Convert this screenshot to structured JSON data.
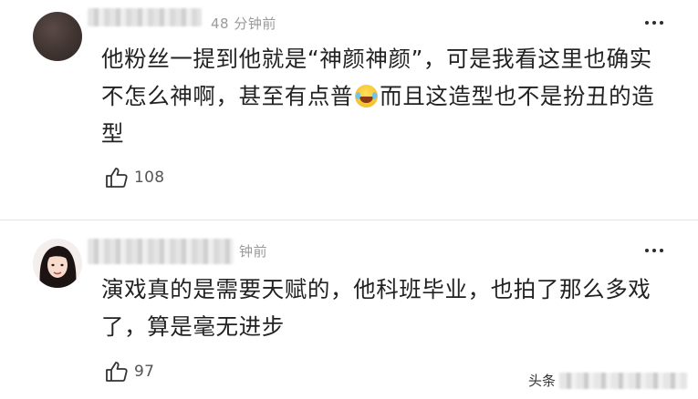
{
  "comments": [
    {
      "time": "48 分钟前",
      "text_before_emoji": "他粉丝一提到他就是“神颜神颜”，可是我看这里也确实不怎么神啊，甚至有点普",
      "emoji": "laughing-crying-emoji",
      "text_after_emoji": "而且这造型也不是扮丑的造型",
      "likes": "108"
    },
    {
      "time": "钟前",
      "text": "演戏真的是需要天赋的，他科班毕业，也拍了那么多戏了，算是毫无进步",
      "likes": "97"
    }
  ],
  "watermark": {
    "label": "头条"
  },
  "colors": {
    "text": "#222222",
    "meta": "#9a9a9a",
    "divider": "#e6e6e6"
  }
}
